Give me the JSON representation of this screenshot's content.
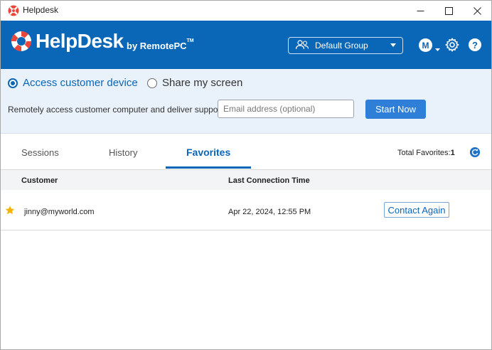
{
  "window": {
    "title": "Helpdesk",
    "controls": [
      "minimize-icon",
      "maximize-icon",
      "close-icon"
    ]
  },
  "header": {
    "logo_text": "HelpDesk",
    "by_text": "by RemotePC",
    "trademark": "TM",
    "group_select": "Default Group",
    "avatar_initial": "M",
    "help_label": "?"
  },
  "access": {
    "option_access": "Access customer device",
    "option_share": "Share my screen",
    "selected": "access",
    "description": "Remotely access customer computer and deliver support",
    "email_placeholder": "Email address (optional)",
    "email_value": "",
    "start_label": "Start Now"
  },
  "tabs": {
    "items": [
      {
        "label": "Sessions",
        "active": false
      },
      {
        "label": "History",
        "active": false
      },
      {
        "label": "Favorites",
        "active": true
      }
    ],
    "total_label": "Total Favorites:",
    "total_count": "1"
  },
  "table": {
    "columns": [
      "Customer",
      "Last Connection Time"
    ],
    "rows": [
      {
        "customer": "jinny@myworld.com",
        "last_connection": "Apr 22, 2024, 12:55 PM",
        "action": "Contact Again",
        "favorite": true
      }
    ]
  },
  "colors": {
    "brand": "#0a66b7",
    "button": "#2f7fd8",
    "panel": "#e9f1fb",
    "star": "#f5b301",
    "logo_red": "#e8473b"
  }
}
